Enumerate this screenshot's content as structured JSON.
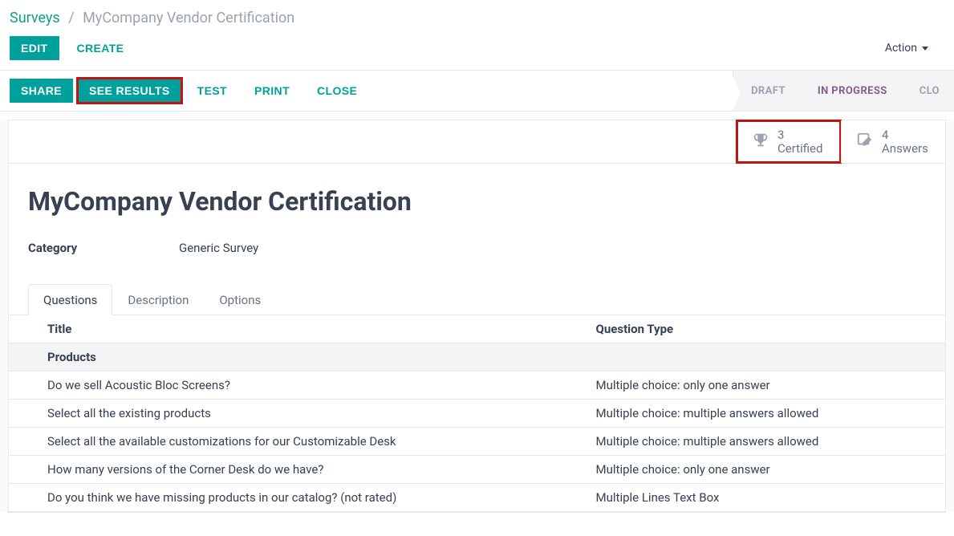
{
  "breadcrumb": {
    "root": "Surveys",
    "current": "MyCompany Vendor Certification"
  },
  "commands": {
    "edit": "EDIT",
    "create": "CREATE",
    "action": "Action"
  },
  "actionbar": {
    "share": "SHARE",
    "see_results": "SEE RESULTS",
    "test": "TEST",
    "print": "PRINT",
    "close": "CLOSE"
  },
  "status": {
    "draft": "DRAFT",
    "in_progress": "IN PROGRESS",
    "closed": "CLO"
  },
  "stats": {
    "certified": {
      "count": "3",
      "label": "Certified"
    },
    "answers": {
      "count": "4",
      "label": "Answers"
    }
  },
  "record": {
    "title": "MyCompany Vendor Certification",
    "category_label": "Category",
    "category_value": "Generic Survey"
  },
  "tabs": {
    "questions": "Questions",
    "description": "Description",
    "options": "Options"
  },
  "table": {
    "header_title": "Title",
    "header_type": "Question Type",
    "rows": [
      {
        "section": true,
        "title": "Products",
        "type": ""
      },
      {
        "section": false,
        "title": "Do we sell Acoustic Bloc Screens?",
        "type": "Multiple choice: only one answer"
      },
      {
        "section": false,
        "title": "Select all the existing products",
        "type": "Multiple choice: multiple answers allowed"
      },
      {
        "section": false,
        "title": "Select all the available customizations for our Customizable Desk",
        "type": "Multiple choice: multiple answers allowed"
      },
      {
        "section": false,
        "title": "How many versions of the Corner Desk do we have?",
        "type": "Multiple choice: only one answer"
      },
      {
        "section": false,
        "title": "Do you think we have missing products in our catalog? (not rated)",
        "type": "Multiple Lines Text Box"
      }
    ]
  }
}
